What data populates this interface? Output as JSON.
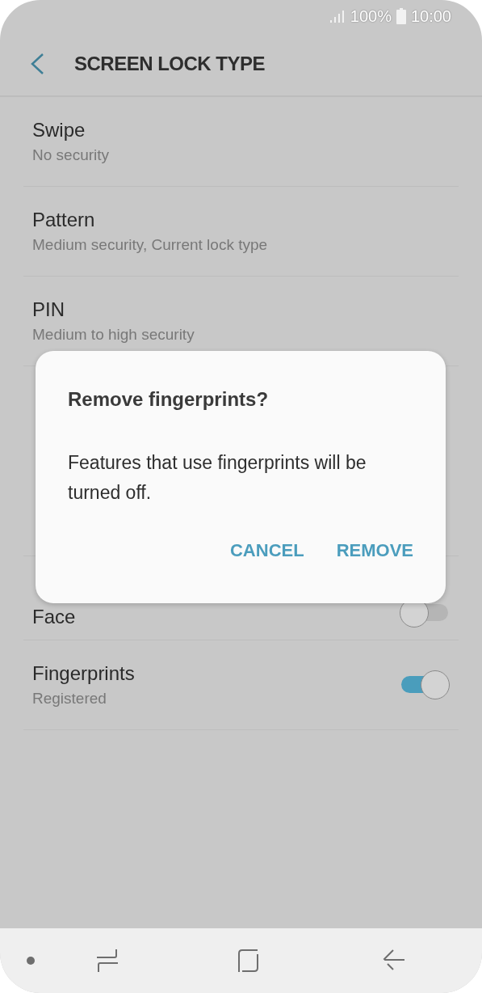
{
  "status_bar": {
    "battery": "100%",
    "time": "10:00"
  },
  "header": {
    "title": "SCREEN LOCK TYPE"
  },
  "options": [
    {
      "kind": "option",
      "title": "Swipe",
      "subtitle": "No security"
    },
    {
      "kind": "option",
      "title": "Pattern",
      "subtitle": "Medium security, Current lock type"
    },
    {
      "kind": "option",
      "title": "PIN",
      "subtitle": "Medium to high security"
    },
    {
      "kind": "hidden"
    },
    {
      "kind": "toggle",
      "title": "Face",
      "on": false
    },
    {
      "kind": "toggle",
      "title": "Fingerprints",
      "subtitle": "Registered",
      "on": true
    }
  ],
  "dialog": {
    "title": "Remove fingerprints?",
    "message": "Features that use fingerprints will be turned off.",
    "buttons": [
      "CANCEL",
      "REMOVE"
    ]
  }
}
